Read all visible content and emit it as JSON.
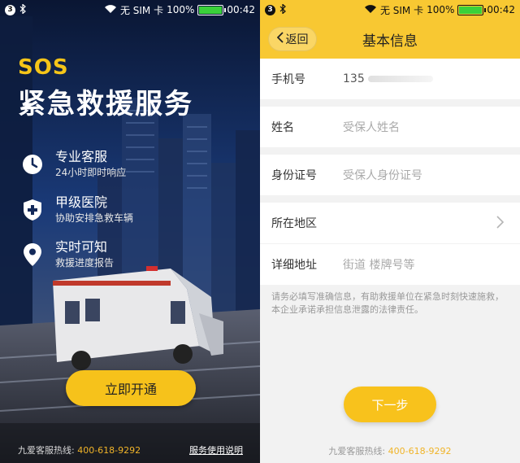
{
  "status_bar": {
    "badge": "3",
    "sim": "无 SIM 卡",
    "battery": "100%",
    "time": "00:42"
  },
  "left_screen": {
    "sos": "SOS",
    "title": "紧急救援服务",
    "features": [
      {
        "icon": "clock-icon",
        "title": "专业客服",
        "subtitle": "24小时即时响应"
      },
      {
        "icon": "hospital-cross-icon",
        "title": "甲级医院",
        "subtitle": "协助安排急救车辆"
      },
      {
        "icon": "location-pin-icon",
        "title": "实时可知",
        "subtitle": "救援进度报告"
      }
    ],
    "open_button": "立即开通",
    "hotline_label": "九爱客服热线: ",
    "hotline_number": "400-618-9292",
    "service_link": "服务使用说明"
  },
  "right_screen": {
    "back": "返回",
    "title": "基本信息",
    "fields": {
      "phone_label": "手机号",
      "phone_value": "135",
      "name_label": "姓名",
      "name_placeholder": "受保人姓名",
      "id_label": "身份证号",
      "id_placeholder": "受保人身份证号",
      "region_label": "所在地区",
      "address_label": "详细地址",
      "address_placeholder": "街道 楼牌号等"
    },
    "notice": "请务必填写准确信息，有助救援单位在紧急时刻快速施救，本企业承诺承担信息泄露的法律责任。",
    "next_button": "下一步",
    "hotline_label": "九爱客服热线: ",
    "hotline_number": "400-618-9292"
  },
  "colors": {
    "accent_yellow": "#f6c21b",
    "hotline_orange": "#f0b428"
  }
}
